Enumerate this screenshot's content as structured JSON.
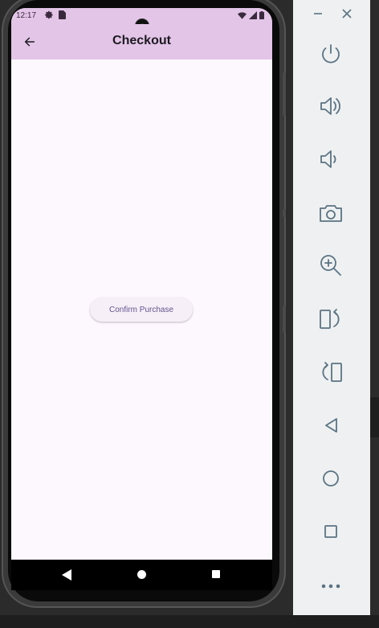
{
  "status_bar": {
    "time": "12:17",
    "left_icons": [
      "settings-icon",
      "sim-card-icon"
    ],
    "right_icons": [
      "wifi-icon",
      "signal-icon",
      "battery-icon"
    ]
  },
  "app_bar": {
    "title": "Checkout",
    "back_icon": "arrow-back-icon"
  },
  "main": {
    "confirm_button_label": "Confirm Purchase"
  },
  "nav_bar": {
    "buttons": [
      "back-triangle",
      "home-circle",
      "recents-square"
    ]
  },
  "emulator_toolbar": {
    "window_controls": [
      "minimize",
      "close"
    ],
    "tools": [
      "power",
      "volume-up",
      "volume-down",
      "screenshot",
      "zoom",
      "rotate-left",
      "rotate-right",
      "back",
      "home",
      "overview",
      "more"
    ]
  },
  "colors": {
    "app_bar": "#e3c5e8",
    "surface": "#fdf7fe",
    "button_text": "#65558f",
    "toolbar_icon": "#5b7383"
  }
}
